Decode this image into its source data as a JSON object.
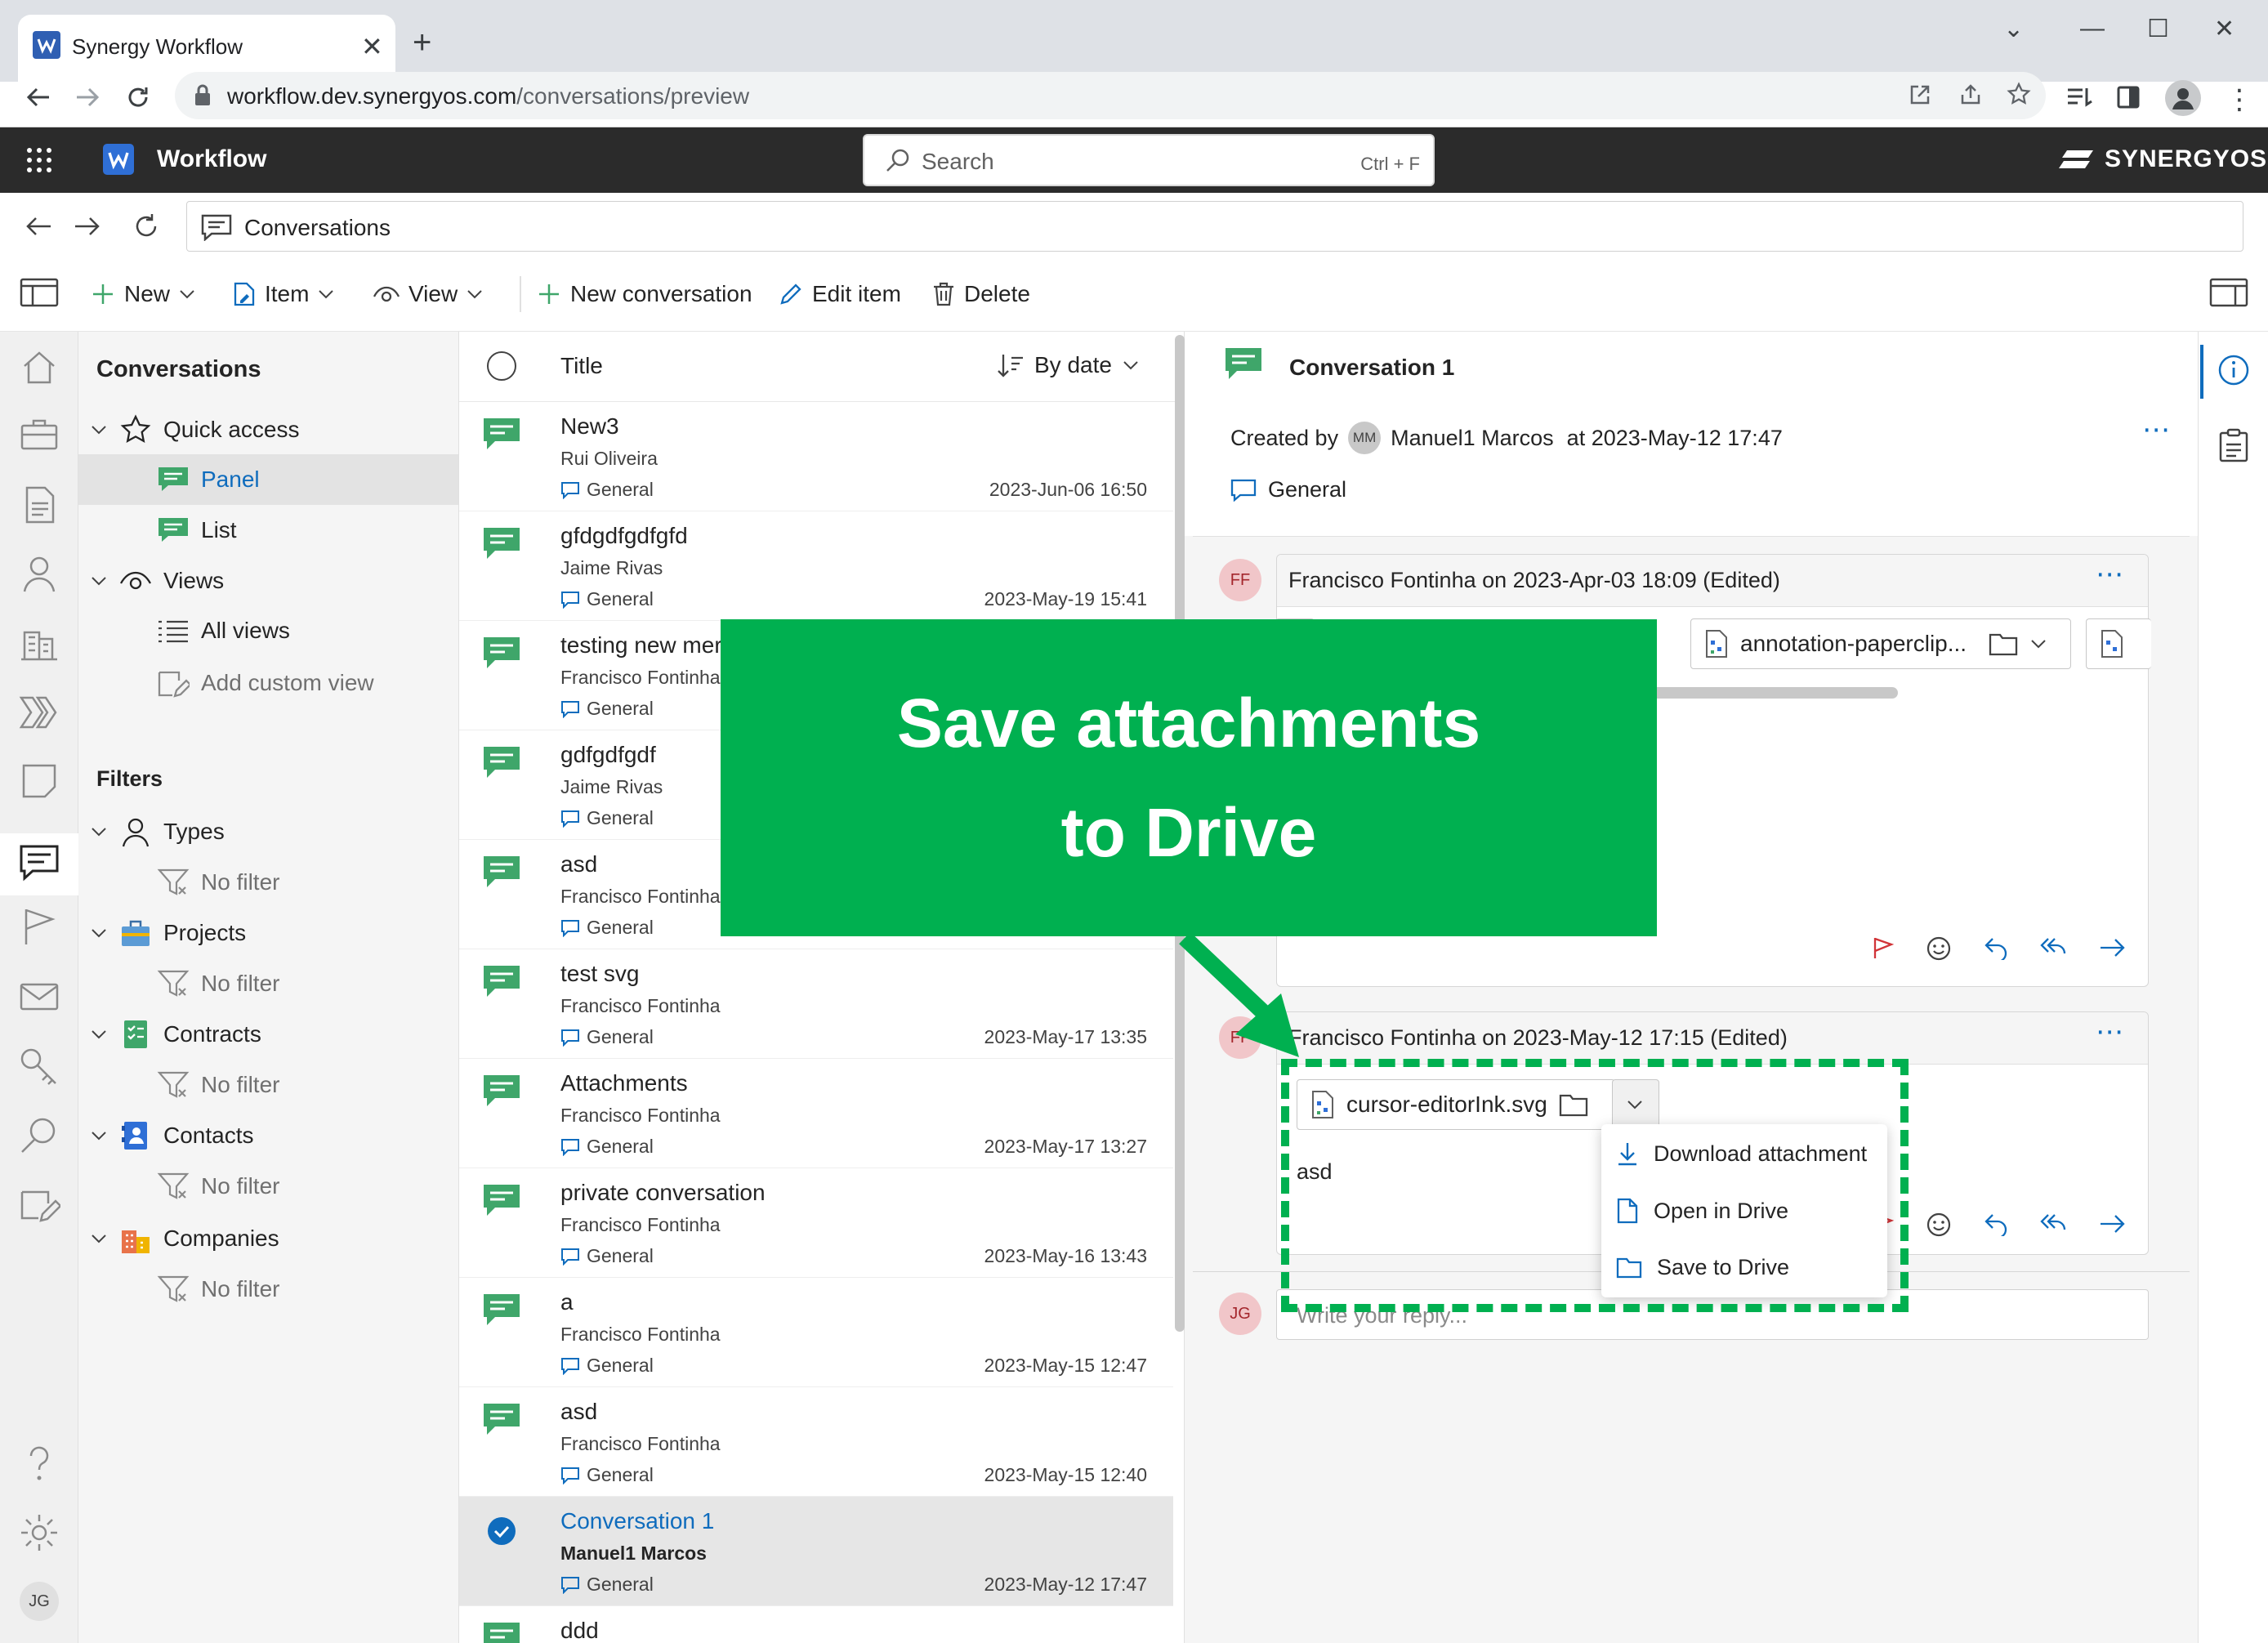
{
  "browser": {
    "tab_title": "Synergy Workflow",
    "url_host": "workflow.dev.synergyos.com",
    "url_path": "/conversations/preview"
  },
  "app": {
    "name": "Workflow",
    "search_placeholder": "Search",
    "search_shortcut": "Ctrl + F",
    "brand": "SYNERGYOS",
    "breadcrumb": "Conversations"
  },
  "toolbar": {
    "new": "New",
    "item": "Item",
    "view": "View",
    "new_conversation": "New conversation",
    "edit_item": "Edit item",
    "delete": "Delete"
  },
  "sidebar": {
    "title": "Conversations",
    "quick_access": "Quick access",
    "panel": "Panel",
    "list": "List",
    "views": "Views",
    "all_views": "All views",
    "add_custom_view": "Add custom view",
    "filters_title": "Filters",
    "filters": [
      {
        "label": "Types",
        "value": "No filter"
      },
      {
        "label": "Projects",
        "value": "No filter"
      },
      {
        "label": "Contracts",
        "value": "No filter"
      },
      {
        "label": "Contacts",
        "value": "No filter"
      },
      {
        "label": "Companies",
        "value": "No filter"
      }
    ],
    "user_initials": "JG"
  },
  "list": {
    "header_title": "Title",
    "sort_label": "By date",
    "rows": [
      {
        "title": "New3",
        "author": "Rui Oliveira",
        "tag": "General",
        "date": "2023-Jun-06 16:50"
      },
      {
        "title": "gfdgdfgdfgfd",
        "author": "Jaime Rivas",
        "tag": "General",
        "date": "2023-May-19 15:41"
      },
      {
        "title": "testing new mer",
        "author": "Francisco Fontinha",
        "tag": "General",
        "date": ""
      },
      {
        "title": "gdfgdfgdf",
        "author": "Jaime Rivas",
        "tag": "General",
        "date": ""
      },
      {
        "title": "asd",
        "author": "Francisco Fontinha",
        "tag": "General",
        "date": ""
      },
      {
        "title": "test svg",
        "author": "Francisco Fontinha",
        "tag": "General",
        "date": "2023-May-17 13:35"
      },
      {
        "title": "Attachments",
        "author": "Francisco Fontinha",
        "tag": "General",
        "date": "2023-May-17 13:27"
      },
      {
        "title": "private conversation",
        "author": "Francisco Fontinha",
        "tag": "General",
        "date": "2023-May-16 13:43"
      },
      {
        "title": "a",
        "author": "Francisco Fontinha",
        "tag": "General",
        "date": "2023-May-15 12:47"
      },
      {
        "title": "asd",
        "author": "Francisco Fontinha",
        "tag": "General",
        "date": "2023-May-15 12:40"
      },
      {
        "title": "Conversation 1",
        "author": "Manuel1 Marcos",
        "tag": "General",
        "date": "2023-May-12 17:47"
      },
      {
        "title": "ddd",
        "author": "",
        "tag": "",
        "date": ""
      }
    ]
  },
  "detail": {
    "title": "Conversation 1",
    "created_by_label": "Created by",
    "creator_initials": "MM",
    "creator": "Manuel1 Marcos",
    "created_at": "at 2023-May-12 17:47",
    "tag": "General",
    "messages": [
      {
        "initials": "FF",
        "header": "Francisco Fontinha on 2023-Apr-03 18:09 (Edited)",
        "attachment": "annotation-paperclip...",
        "body": ""
      },
      {
        "initials": "FF",
        "header": "Francisco Fontinha on 2023-May-12 17:15 (Edited)",
        "attachment": "cursor-editorInk.svg",
        "body": "asd"
      }
    ],
    "reply_initials": "JG",
    "reply_placeholder": "Write your reply..."
  },
  "menu": {
    "download": "Download attachment",
    "open": "Open in Drive",
    "save": "Save to Drive"
  },
  "callout": {
    "line1": "Save attachments",
    "line2": "to Drive"
  },
  "colors": {
    "accent": "#0f6cbd",
    "callout": "#00b050",
    "chat_icon": "#3fa66a"
  }
}
